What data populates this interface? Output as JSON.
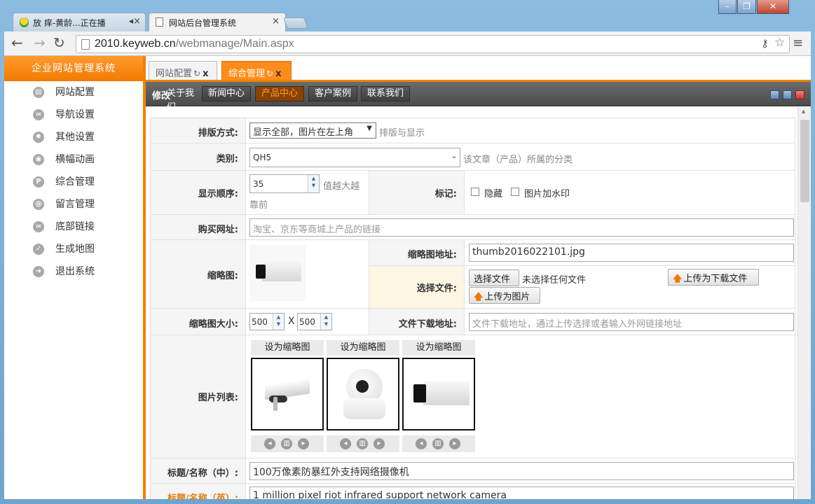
{
  "browser": {
    "tabs": [
      {
        "label": "放 痒-黄龄...正在播",
        "audio_icon": "speaker-icon"
      },
      {
        "label": "网站后台管理系统"
      }
    ],
    "url_host": "2010.keyweb.cn",
    "url_path": "/webmanage/Main.aspx"
  },
  "sidebar": {
    "title": "企业网站管理系统",
    "items": [
      {
        "label": "网站配置",
        "icon": "settings-icon"
      },
      {
        "label": "导航设置",
        "icon": "link-icon"
      },
      {
        "label": "其他设置",
        "icon": "gear-icon"
      },
      {
        "label": "横幅动画",
        "icon": "camera-icon"
      },
      {
        "label": "综合管理",
        "icon": "p-icon"
      },
      {
        "label": "留言管理",
        "icon": "at-icon"
      },
      {
        "label": "底部链接",
        "icon": "link-icon"
      },
      {
        "label": "生成地图",
        "icon": "check-icon"
      },
      {
        "label": "退出系统",
        "icon": "arrow-right-icon"
      }
    ]
  },
  "main_tabs": [
    {
      "label": "网站配置"
    },
    {
      "label": "综合管理"
    }
  ],
  "subbar": {
    "edit_label": "修改",
    "buttons": [
      "关于我们",
      "新闻中心",
      "产品中心",
      "客户案例",
      "联系我们"
    ],
    "active": "产品中心"
  },
  "form": {
    "layout_label": "排版方式:",
    "layout_value": "显示全部，图片在左上角",
    "layout_hint": "排版与显示",
    "category_label": "类别:",
    "category_value": "QH5",
    "category_hint": "该文章（产品）所属的分类",
    "order_label": "显示顺序:",
    "order_value": "35",
    "order_hint": "值越大越靠前",
    "order_hint_line1": "值越大越",
    "order_hint_line2": "靠前",
    "flag_label": "标记:",
    "flag_hidden": "隐藏",
    "flag_watermark": "图片加水印",
    "buy_label": "购买网址:",
    "buy_placeholder": "淘宝、京东等商城上产品的链接",
    "thumb_label": "缩略图:",
    "thumb_addr_label": "缩略图地址:",
    "thumb_addr_value": "thumb2016022101.jpg",
    "choose_label": "选择文件:",
    "choose_btn": "选择文件",
    "no_file": "未选择任何文件",
    "upload_download": "上传为下载文件",
    "upload_image": "上传为图片",
    "size_label": "缩略图大小:",
    "size_w": "500",
    "size_x": "X",
    "size_h": "500",
    "download_label": "文件下载地址:",
    "download_placeholder": "文件下载地址，通过上传选择或者输入外网链接地址",
    "piclist_label": "图片列表:",
    "set_thumb": "设为缩略图",
    "title_cn_label": "标题/名称（中）:",
    "title_cn_value": "100万像素防暴红外支持网络摄像机",
    "title_en_label": "标题/名称（英）:",
    "title_en_value": "1 million pixel riot infrared support network camera"
  },
  "colors": {
    "accent": "#f08200",
    "subbar": "#4b4b4b",
    "active_tab": "#ff8c1a"
  }
}
